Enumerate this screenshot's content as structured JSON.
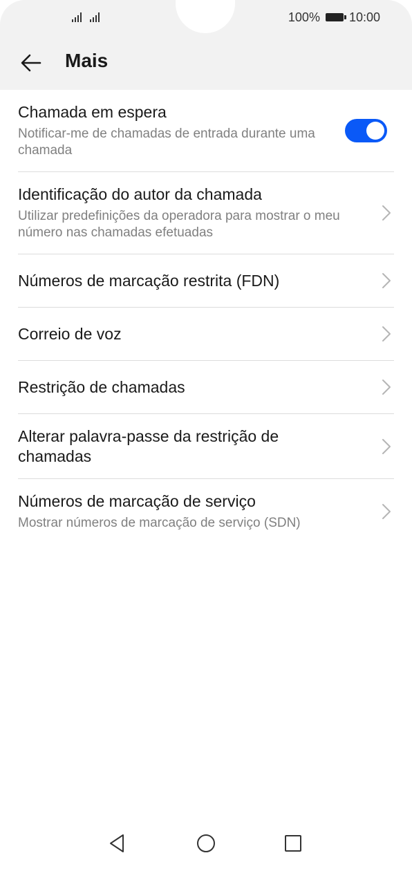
{
  "status_bar": {
    "battery_percent": "100%",
    "time": "10:00",
    "signal_icons": [
      "signal-icon",
      "signal-icon"
    ],
    "battery_icon": "battery-icon"
  },
  "header": {
    "back_icon": "back-arrow-icon",
    "title": "Mais"
  },
  "settings": [
    {
      "title": "Chamada em espera",
      "subtitle": "Notificar-me de chamadas de entrada durante uma chamada",
      "control": "toggle",
      "enabled": true
    },
    {
      "title": "Identificação do autor da chamada",
      "subtitle": "Utilizar predefinições da operadora para mostrar o meu número nas chamadas efetuadas",
      "control": "chevron"
    },
    {
      "title": "Números de marcação restrita (FDN)",
      "subtitle": "",
      "control": "chevron"
    },
    {
      "title": "Correio de voz",
      "subtitle": "",
      "control": "chevron"
    },
    {
      "title": "Restrição de chamadas",
      "subtitle": "",
      "control": "chevron"
    },
    {
      "title": "Alterar palavra-passe da restrição de chamadas",
      "subtitle": "",
      "control": "chevron"
    },
    {
      "title": "Números de marcação de serviço",
      "subtitle": "Mostrar números de marcação de serviço (SDN)",
      "control": "chevron"
    }
  ],
  "colors": {
    "accent": "#0a59f7",
    "header_bg": "#f2f2f2",
    "subtitle": "#808080",
    "divider": "#dcdcdc"
  },
  "nav_bar": [
    "back-triangle-icon",
    "home-circle-icon",
    "recents-square-icon"
  ]
}
